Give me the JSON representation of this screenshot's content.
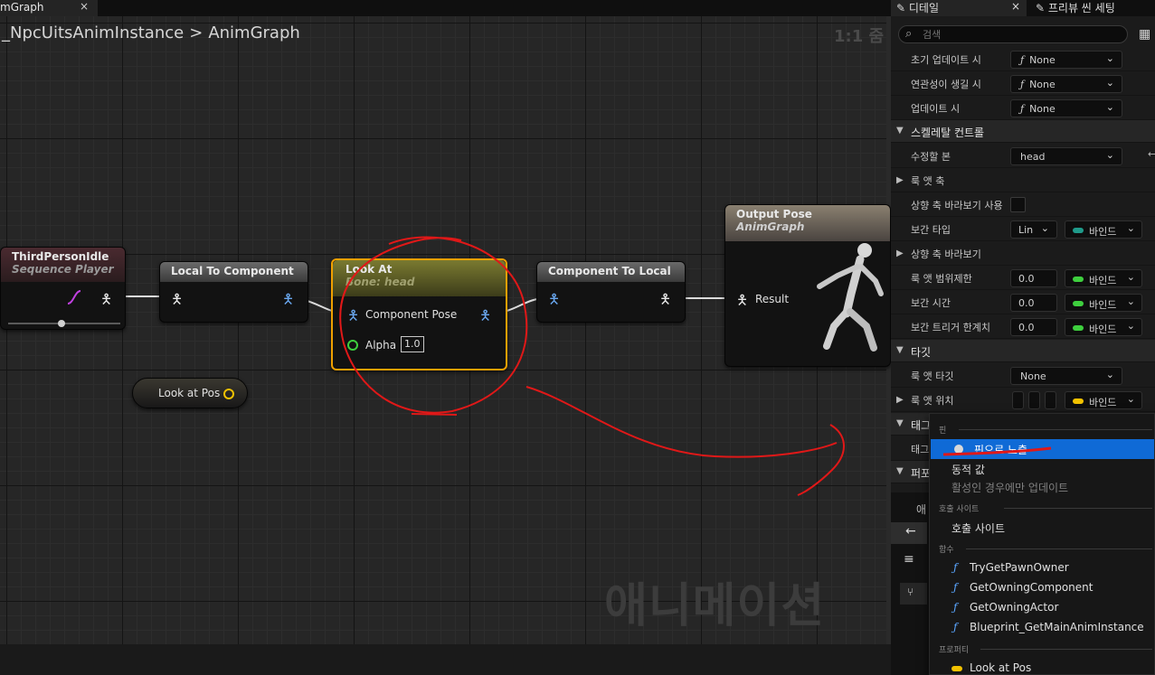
{
  "graph_tab": {
    "title": "mGraph",
    "close": "×"
  },
  "breadcrumb": {
    "part1": "_NpcUitsAnimInstance",
    "sep": ">",
    "part2": "AnimGraph"
  },
  "zoom_label": "1:1 줌",
  "watermark": "애니메이션",
  "nodes": {
    "third_person_idle": {
      "title": "ThirdPersonIdle",
      "subtitle": "Sequence Player"
    },
    "local_to_component": {
      "title": "Local To Component"
    },
    "look_at": {
      "title": "Look At",
      "subtitle": "Bone: head",
      "pin_component_pose": "Component Pose",
      "pin_alpha": "Alpha",
      "alpha_value": "1.0"
    },
    "component_to_local": {
      "title": "Component To Local"
    },
    "output_pose": {
      "title": "Output Pose",
      "subtitle": "AnimGraph",
      "pin_result": "Result"
    },
    "look_at_pos": {
      "title": "Look at Pos"
    }
  },
  "panel": {
    "tabs": {
      "details": "디테일",
      "preview": "프리뷰 씬 세팅"
    },
    "search_placeholder": "검색",
    "rows": {
      "initial_update": {
        "label": "초기 업데이트 시",
        "value": "None"
      },
      "become_relevant": {
        "label": "연관성이 생길 시",
        "value": "None"
      },
      "on_update": {
        "label": "업데이트 시",
        "value": "None"
      },
      "skeletal_control": {
        "label": "스켈레탈 컨트롤"
      },
      "bone_to_modify": {
        "label": "수정할 본",
        "value": "head"
      },
      "look_at_axis": {
        "label": "룩 앳 축"
      },
      "use_look_up_axis": {
        "label": "상향 축 바라보기 사용"
      },
      "interp_type": {
        "label": "보간 타입",
        "value": "Lin"
      },
      "look_up_axis": {
        "label": "상향 축 바라보기"
      },
      "look_at_clamp": {
        "label": "룩 앳 범위제한",
        "value": "0.0"
      },
      "interp_time": {
        "label": "보간 시간",
        "value": "0.0"
      },
      "interp_trigger": {
        "label": "보간 트리거 한계치",
        "value": "0.0"
      },
      "target": {
        "label": "타깃"
      },
      "look_at_target": {
        "label": "룩 앳 타깃",
        "value": "None"
      },
      "look_at_location": {
        "label": "룩 앳 위치"
      },
      "tag_cat": {
        "label": "태그"
      },
      "tag_row": {
        "label": "태그"
      },
      "pers": {
        "label": "퍼포"
      },
      "anim": {
        "label": "애"
      }
    },
    "bind_label": "바인드"
  },
  "menu": {
    "sec_pin": "핀",
    "expose_pin": "핀으로 노출",
    "dynamic_value": "동적 값",
    "update_when_active": "활성인 경우에만 업데이트",
    "sec_call_site": "호출 사이트",
    "call_site": "호출 사이트",
    "sec_functions": "함수",
    "functions": [
      "TryGetPawnOwner",
      "GetOwningComponent",
      "GetOwningActor",
      "Blueprint_GetMainAnimInstance"
    ],
    "sec_properties": "프로퍼티",
    "property": "Look at Pos"
  },
  "colors": {
    "bind_green": "#3ecf3e",
    "bind_teal": "#1f9a8a",
    "bind_yellow": "#f2c200",
    "selection": "#0f6ad6",
    "annotation": "#e01818"
  }
}
